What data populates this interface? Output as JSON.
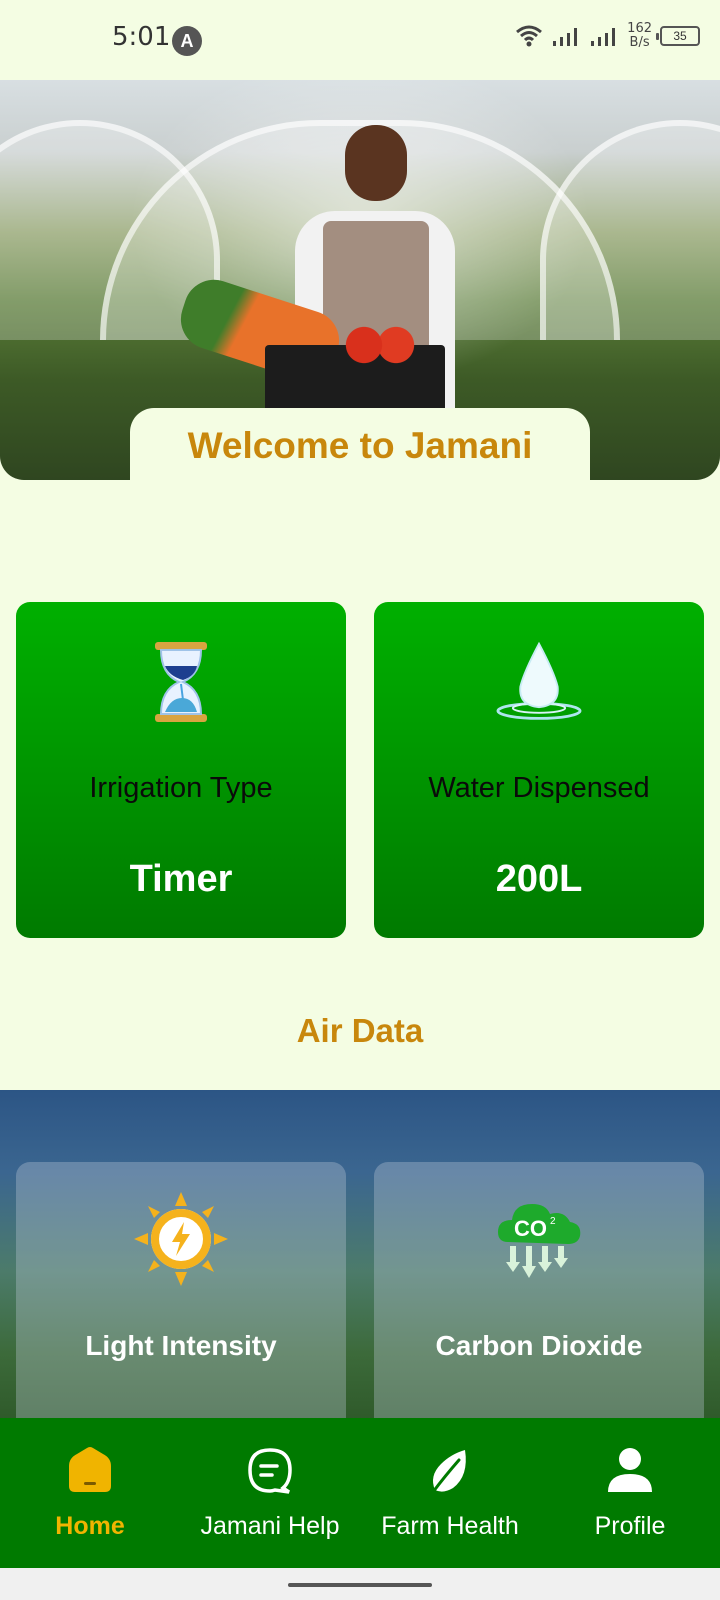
{
  "status_bar": {
    "time": "5:01",
    "notification_letter": "A",
    "speed_value": "162",
    "speed_unit": "B/s",
    "battery": "35"
  },
  "hero": {
    "welcome": "Welcome to Jamani"
  },
  "water_cards": [
    {
      "label": "Irrigation Type",
      "value": "Timer",
      "icon": "hourglass-icon"
    },
    {
      "label": "Water Dispensed",
      "value": "200L",
      "icon": "water-drop-icon"
    }
  ],
  "air_section": {
    "title": "Air Data",
    "cards": [
      {
        "label": "Light Intensity",
        "icon": "sun-lightning-icon"
      },
      {
        "label": "Carbon Dioxide",
        "icon": "co2-cloud-icon"
      }
    ]
  },
  "nav": {
    "items": [
      {
        "label": "Home",
        "icon": "home-icon",
        "active": true
      },
      {
        "label": "Jamani Help",
        "icon": "chat-icon",
        "active": false
      },
      {
        "label": "Farm Health",
        "icon": "leaf-icon",
        "active": false
      },
      {
        "label": "Profile",
        "icon": "person-icon",
        "active": false
      }
    ]
  },
  "colors": {
    "background": "#f4fde3",
    "accent": "#c8870c",
    "card_green": "#00b000",
    "nav_green": "#007a00",
    "nav_active": "#f0b400"
  }
}
